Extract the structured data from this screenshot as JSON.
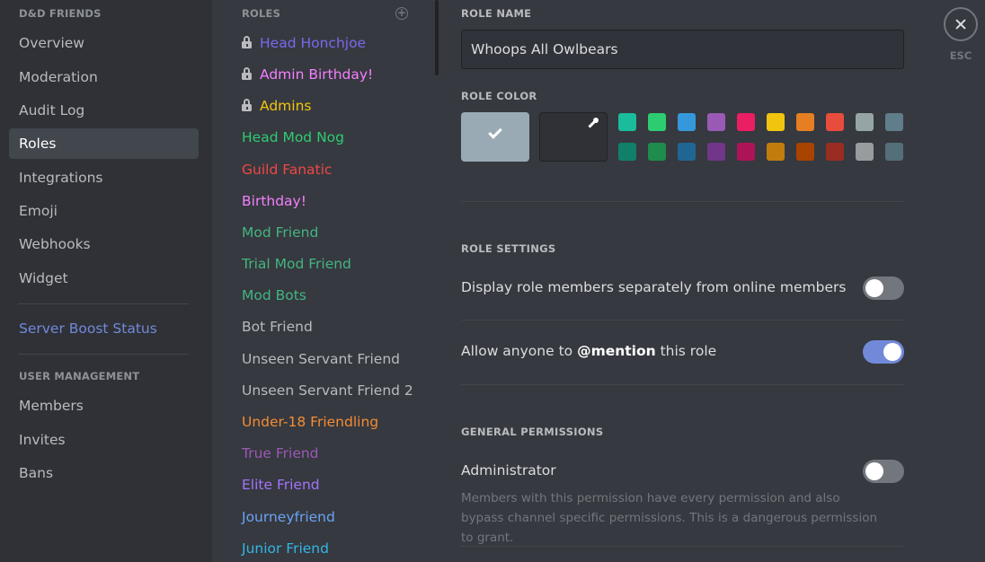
{
  "sidebar": {
    "server_header": "D&D FRIENDS",
    "items": [
      {
        "label": "Overview"
      },
      {
        "label": "Moderation"
      },
      {
        "label": "Audit Log"
      },
      {
        "label": "Roles"
      },
      {
        "label": "Integrations"
      },
      {
        "label": "Emoji"
      },
      {
        "label": "Webhooks"
      },
      {
        "label": "Widget"
      }
    ],
    "boost_label": "Server Boost Status",
    "user_management_header": "USER MANAGEMENT",
    "user_items": [
      {
        "label": "Members"
      },
      {
        "label": "Invites"
      },
      {
        "label": "Bans"
      }
    ]
  },
  "roles": {
    "header": "ROLES",
    "add_icon": "plus-circle-icon",
    "list": [
      {
        "name": "Head Honchjoe",
        "color": "#7b68ee",
        "locked": true
      },
      {
        "name": "Admin Birthday!",
        "color": "#f47fff",
        "locked": true
      },
      {
        "name": "Admins",
        "color": "#f1c40f",
        "locked": true
      },
      {
        "name": "Head Mod Nog",
        "color": "#2ecc71",
        "locked": false
      },
      {
        "name": "Guild Fanatic",
        "color": "#f04747",
        "locked": false
      },
      {
        "name": "Birthday!",
        "color": "#f47fff",
        "locked": false
      },
      {
        "name": "Mod Friend",
        "color": "#43b581",
        "locked": false
      },
      {
        "name": "Trial Mod Friend",
        "color": "#43b581",
        "locked": false
      },
      {
        "name": "Mod Bots",
        "color": "#43b581",
        "locked": false
      },
      {
        "name": "Bot Friend",
        "color": "#b9bbbe",
        "locked": false
      },
      {
        "name": "Unseen Servant Friend",
        "color": "#b9bbbe",
        "locked": false
      },
      {
        "name": "Unseen Servant Friend 2",
        "color": "#b9bbbe",
        "locked": false
      },
      {
        "name": "Under-18 Friendling",
        "color": "#f48c36",
        "locked": false
      },
      {
        "name": "True Friend",
        "color": "#9b59b6",
        "locked": false
      },
      {
        "name": "Elite Friend",
        "color": "#a473ff",
        "locked": false
      },
      {
        "name": "Journeyfriend",
        "color": "#6aa3f5",
        "locked": false
      },
      {
        "name": "Junior Friend",
        "color": "#33b5e5",
        "locked": false
      }
    ]
  },
  "editor": {
    "role_name_label": "ROLE NAME",
    "role_name_value": "Whoops All Owlbears",
    "role_color_label": "ROLE COLOR",
    "default_color": "#99aab5",
    "swatches_row1": [
      "#1abc9c",
      "#2ecc71",
      "#3498db",
      "#9b59b6",
      "#e91e63",
      "#f1c40f",
      "#e67e22",
      "#e74c3c",
      "#95a5a6",
      "#607d8b"
    ],
    "swatches_row2": [
      "#11806a",
      "#1f8b4c",
      "#206694",
      "#71368a",
      "#ad1457",
      "#c27c0e",
      "#a84300",
      "#992d22",
      "#979c9f",
      "#546e7a"
    ],
    "role_settings_label": "ROLE SETTINGS",
    "display_separately_label": "Display role members separately from online members",
    "display_separately_on": false,
    "mention_prefix": "Allow anyone to ",
    "mention_bold": "@mention",
    "mention_suffix": " this role",
    "mention_on": true,
    "general_permissions_label": "GENERAL PERMISSIONS",
    "administrator_label": "Administrator",
    "administrator_on": false,
    "administrator_desc": "Members with this permission have every permission and also bypass channel specific permissions. This is a dangerous permission to grant."
  },
  "close": {
    "esc_label": "ESC"
  }
}
